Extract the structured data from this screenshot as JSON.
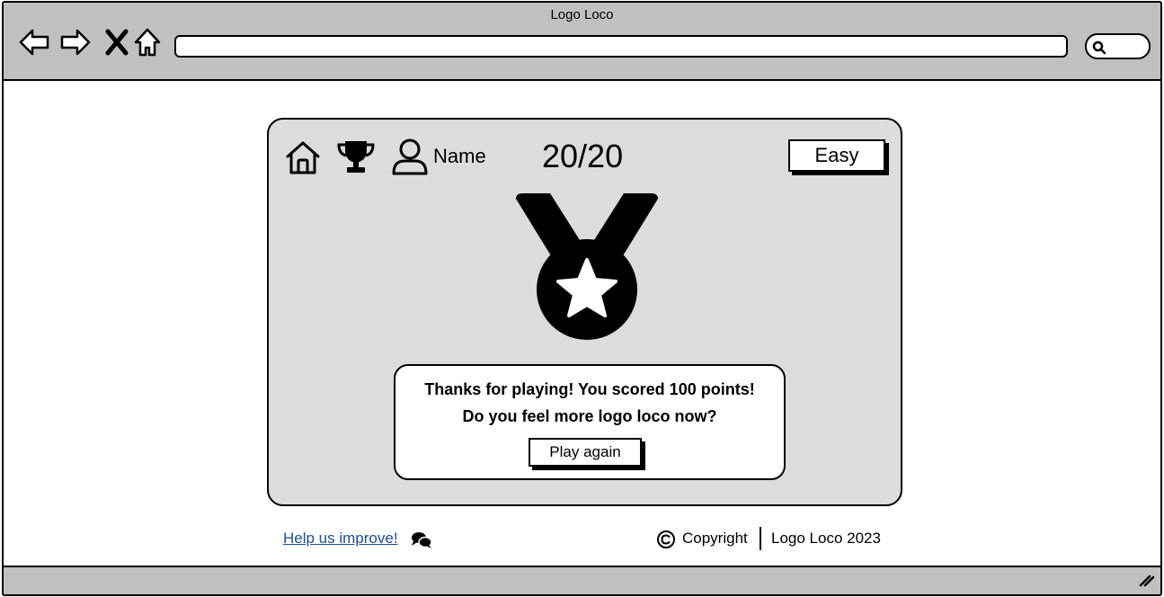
{
  "browser": {
    "title": "Logo Loco",
    "nav": [
      {
        "name": "back-icon"
      },
      {
        "name": "forward-icon"
      },
      {
        "name": "stop-icon"
      },
      {
        "name": "home-icon"
      }
    ],
    "url": "",
    "search_icon": "search-icon"
  },
  "game": {
    "icons": [
      "home-icon",
      "trophy-icon",
      "user-icon"
    ],
    "user_name": "Name",
    "score": "20/20",
    "difficulty": "Easy",
    "medal_icon": "medal-star-icon",
    "result": {
      "line1": "Thanks for playing! You scored 100 points!",
      "line2": "Do you feel more logo loco now?",
      "play_again": "Play again"
    }
  },
  "footer": {
    "help_link": "Help us improve!",
    "chat_icon": "chat-icon",
    "copyright_label": "Copyright",
    "brand_year": "Logo Loco 2023"
  }
}
